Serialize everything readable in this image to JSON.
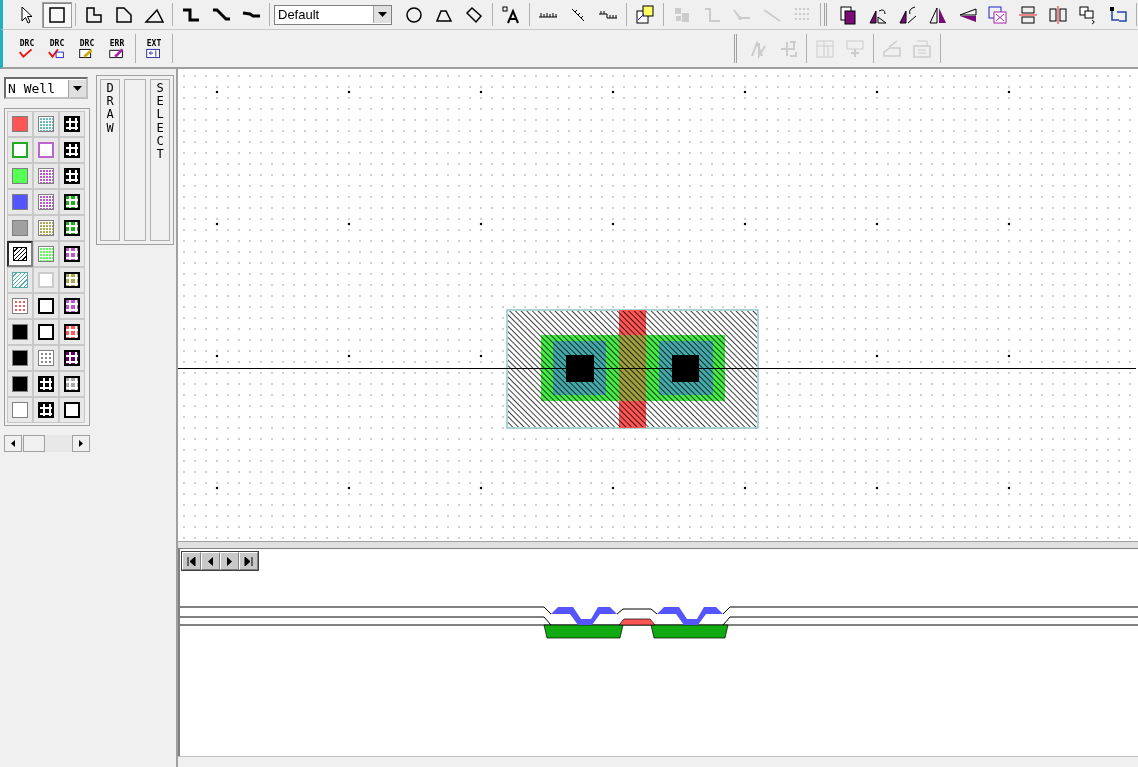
{
  "toolbar": {
    "rows": [
      {
        "groups": [
          {
            "items": [
              {
                "kind": "pointer",
                "selected": false,
                "disabled": false
              },
              {
                "kind": "box",
                "selected": true,
                "disabled": false
              }
            ]
          },
          {
            "items": [
              {
                "kind": "l-poly",
                "selected": false,
                "disabled": false
              },
              {
                "kind": "cut-poly",
                "selected": false,
                "disabled": false
              },
              {
                "kind": "triangle",
                "selected": false,
                "disabled": false
              }
            ]
          },
          {
            "items": [
              {
                "kind": "step-wire",
                "selected": false,
                "disabled": false
              },
              {
                "kind": "diag-wire",
                "selected": false,
                "disabled": false
              },
              {
                "kind": "flat-wire",
                "selected": false,
                "disabled": false
              }
            ]
          },
          {
            "dropdown": "Default"
          },
          {
            "items": [
              {
                "kind": "circle",
                "selected": false,
                "disabled": false
              },
              {
                "kind": "arch",
                "selected": false,
                "disabled": false
              },
              {
                "kind": "slant",
                "selected": false,
                "disabled": false
              }
            ]
          },
          {
            "items": [
              {
                "kind": "text-tool",
                "selected": false,
                "disabled": false
              }
            ]
          },
          {
            "items": [
              {
                "kind": "ruler",
                "selected": false,
                "disabled": false
              },
              {
                "kind": "ruler-diag",
                "selected": false,
                "disabled": false
              },
              {
                "kind": "ruler-step",
                "selected": false,
                "disabled": false
              }
            ]
          },
          {
            "items": [
              {
                "kind": "instance",
                "selected": false,
                "disabled": false
              }
            ]
          },
          {
            "items": [
              {
                "kind": "cell",
                "selected": false,
                "disabled": true
              },
              {
                "kind": "corner-connector",
                "selected": false,
                "disabled": true
              },
              {
                "kind": "connector",
                "selected": false,
                "disabled": true
              },
              {
                "kind": "line",
                "selected": false,
                "disabled": true
              },
              {
                "kind": "dot-grid",
                "selected": false,
                "disabled": true
              }
            ]
          },
          {
            "grip": true,
            "items": [
              {
                "kind": "copy",
                "selected": false,
                "disabled": false
              },
              {
                "kind": "rotate-left",
                "selected": false,
                "disabled": false
              },
              {
                "kind": "rotate-right",
                "selected": false,
                "disabled": false
              },
              {
                "kind": "flip-h",
                "selected": false,
                "disabled": false
              },
              {
                "kind": "flip-v",
                "selected": false,
                "disabled": false
              },
              {
                "kind": "merge",
                "selected": false,
                "disabled": false
              },
              {
                "kind": "slice-h",
                "selected": false,
                "disabled": false
              },
              {
                "kind": "slice-v",
                "selected": false,
                "disabled": false
              },
              {
                "kind": "group",
                "selected": false,
                "disabled": false
              },
              {
                "kind": "ungroup",
                "selected": false,
                "disabled": false
              }
            ]
          }
        ]
      },
      {
        "groups": [
          {
            "items": [
              {
                "kind": "drc-check",
                "label": "DRC",
                "disabled": false
              },
              {
                "kind": "drc-box",
                "label": "DRC",
                "disabled": false
              },
              {
                "kind": "drc-doc",
                "label": "DRC",
                "disabled": false
              },
              {
                "kind": "err-edit",
                "label": "ERR",
                "disabled": false
              }
            ]
          },
          {
            "items": [
              {
                "kind": "ext",
                "label": "EXT",
                "disabled": false
              }
            ]
          },
          {
            "grip": true,
            "items": [
              {
                "kind": "node-tool",
                "disabled": true
              },
              {
                "kind": "port",
                "disabled": true
              }
            ]
          },
          {
            "items": [
              {
                "kind": "cell-split",
                "disabled": true
              },
              {
                "kind": "cell-merge",
                "disabled": true
              }
            ]
          },
          {
            "items": [
              {
                "kind": "label-edit",
                "disabled": true
              },
              {
                "kind": "label-box",
                "disabled": true
              }
            ]
          }
        ]
      }
    ]
  },
  "layer_select": {
    "value": "N Well"
  },
  "palette": [
    {
      "kind": "solid",
      "color": "#ff5555",
      "selected": false
    },
    {
      "kind": "checker",
      "color": "#66bbbb",
      "selected": false
    },
    {
      "kind": "glyph",
      "color": "#000000",
      "selected": false
    },
    {
      "kind": "outline",
      "color": "#22aa22",
      "selected": false
    },
    {
      "kind": "outline",
      "color": "#bb66cc",
      "selected": false
    },
    {
      "kind": "glyph",
      "color": "#000000",
      "selected": false
    },
    {
      "kind": "solid",
      "color": "#55ff55",
      "selected": false
    },
    {
      "kind": "checker",
      "color": "#bb55cc",
      "selected": false
    },
    {
      "kind": "glyph",
      "color": "#000000",
      "selected": false
    },
    {
      "kind": "solid",
      "color": "#5555ff",
      "selected": false
    },
    {
      "kind": "checker",
      "color": "#bb55cc",
      "selected": false
    },
    {
      "kind": "glyph",
      "color": "#22aa22",
      "selected": false
    },
    {
      "kind": "solid",
      "color": "#a0a0a0",
      "selected": false
    },
    {
      "kind": "checker",
      "color": "#aaaa55",
      "selected": false
    },
    {
      "kind": "glyph",
      "color": "#22aa22",
      "selected": false
    },
    {
      "kind": "hatch",
      "color": "#000000",
      "selected": true
    },
    {
      "kind": "checker",
      "color": "#55ff55",
      "selected": false
    },
    {
      "kind": "glyph",
      "color": "#bb55cc",
      "selected": false
    },
    {
      "kind": "hatch",
      "color": "#55aaaa",
      "selected": false
    },
    {
      "kind": "outline",
      "color": "#cccccc",
      "selected": false
    },
    {
      "kind": "glyph",
      "color": "#aaaa55",
      "selected": false
    },
    {
      "kind": "dots",
      "color": "#ff5555",
      "selected": false
    },
    {
      "kind": "outline",
      "color": "#000000",
      "selected": false
    },
    {
      "kind": "glyph",
      "color": "#bb55cc",
      "selected": false
    },
    {
      "kind": "solid",
      "color": "#000000",
      "selected": false
    },
    {
      "kind": "outline",
      "color": "#000000",
      "selected": false
    },
    {
      "kind": "glyph",
      "color": "#ff5555",
      "selected": false
    },
    {
      "kind": "solid",
      "color": "#000000",
      "selected": false
    },
    {
      "kind": "dots",
      "color": "#888888",
      "selected": false
    },
    {
      "kind": "glyph",
      "color": "#660066",
      "selected": false
    },
    {
      "kind": "solid",
      "color": "#000000",
      "selected": false
    },
    {
      "kind": "glyph",
      "color": "#000000",
      "selected": false
    },
    {
      "kind": "glyph",
      "color": "#aaaaaa",
      "selected": false
    },
    {
      "kind": "solid",
      "color": "#ffffff",
      "selected": false
    },
    {
      "kind": "glyph",
      "color": "#000000",
      "selected": false
    },
    {
      "kind": "outline",
      "color": "#000000",
      "selected": false
    }
  ],
  "mode_tabs": [
    {
      "label": "DRAW",
      "selected": false
    },
    {
      "label": "SELECT",
      "selected": false
    }
  ]
}
